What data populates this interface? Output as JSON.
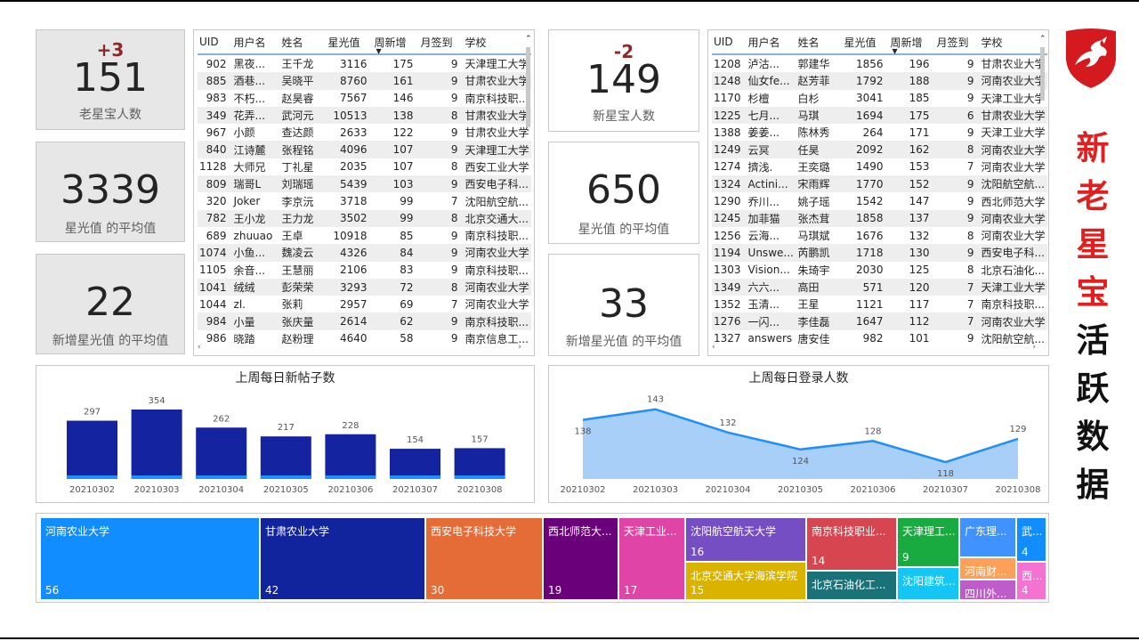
{
  "title_chars": [
    {
      "c": "新",
      "color": "#e02020"
    },
    {
      "c": "老",
      "color": "#e02020"
    },
    {
      "c": "星",
      "color": "#e02020"
    },
    {
      "c": "宝",
      "color": "#e02020"
    },
    {
      "c": "活",
      "color": "#111111"
    },
    {
      "c": "跃",
      "color": "#111111"
    },
    {
      "c": "数",
      "color": "#111111"
    },
    {
      "c": "据",
      "color": "#111111"
    }
  ],
  "logo_icon": "red-dragon-shield-icon",
  "old_cards": [
    {
      "delta": "+3",
      "value": "151",
      "label": "老星宝人数"
    },
    {
      "value": "3339",
      "label": "星光值 的平均值"
    },
    {
      "value": "22",
      "label": "新增星光值 的平均值"
    }
  ],
  "new_cards": [
    {
      "delta": "-2",
      "value": "149",
      "label": "新星宝人数"
    },
    {
      "value": "650",
      "label": "星光值 的平均值"
    },
    {
      "value": "33",
      "label": "新增星光值 的平均值"
    }
  ],
  "table_headers": [
    "UID",
    "用户名",
    "姓名",
    "星光值",
    "周新增",
    "月签到",
    "学校"
  ],
  "old_table": [
    [
      "902",
      "黑夜...",
      "王千龙",
      "3116",
      "175",
      "9",
      "天津理工大学"
    ],
    [
      "885",
      "酒巷...",
      "吴晓平",
      "8760",
      "161",
      "9",
      "甘肃农业大学"
    ],
    [
      "983",
      "不朽...",
      "赵昊睿",
      "7567",
      "146",
      "9",
      "南京科技职..."
    ],
    [
      "349",
      "花弄...",
      "武河元",
      "10513",
      "138",
      "8",
      "甘肃农业大学"
    ],
    [
      "967",
      "小颜",
      "查达颜",
      "2633",
      "122",
      "9",
      "甘肃农业大学"
    ],
    [
      "840",
      "江诗麓",
      "张程铭",
      "4096",
      "107",
      "9",
      "天津理工大学"
    ],
    [
      "1128",
      "大师兄",
      "丁礼星",
      "2035",
      "107",
      "8",
      "西安工业大学"
    ],
    [
      "809",
      "瑞哥L",
      "刘瑞瑶",
      "5439",
      "103",
      "9",
      "西安电子科..."
    ],
    [
      "320",
      "Joker",
      "李京沅",
      "3718",
      "99",
      "7",
      "沈阳航空航..."
    ],
    [
      "782",
      "王小龙",
      "王力龙",
      "3502",
      "99",
      "8",
      "北京交通大..."
    ],
    [
      "689",
      "zhuuao",
      "王卓",
      "10918",
      "85",
      "9",
      "南京科技职..."
    ],
    [
      "1074",
      "小鱼...",
      "魏凌云",
      "4326",
      "84",
      "9",
      "河南农业大学"
    ],
    [
      "1105",
      "余音...",
      "王慧丽",
      "2106",
      "83",
      "9",
      "南京科技职..."
    ],
    [
      "1041",
      "绒绒",
      "彭荣荣",
      "3293",
      "72",
      "8",
      "河南农业大学"
    ],
    [
      "1044",
      "zl.",
      "张莉",
      "2957",
      "69",
      "7",
      "河南农业大学"
    ],
    [
      "984",
      "小量",
      "张庆量",
      "2614",
      "62",
      "9",
      "南京科技职..."
    ],
    [
      "986",
      "晓踏",
      "赵粉理",
      "4640",
      "58",
      "9",
      "南京信息工..."
    ]
  ],
  "new_table": [
    [
      "1208",
      "泸沽...",
      "郭建华",
      "1856",
      "196",
      "9",
      "甘肃农业大学"
    ],
    [
      "1248",
      "仙女fe...",
      "赵芳菲",
      "1792",
      "188",
      "9",
      "河南农业大学"
    ],
    [
      "1170",
      "杉檀",
      "白杉",
      "3041",
      "185",
      "9",
      "天津工业大学"
    ],
    [
      "1225",
      "七月...",
      "马琪",
      "1694",
      "175",
      "6",
      "甘肃农业大学"
    ],
    [
      "1388",
      "姜姜...",
      "陈林秀",
      "264",
      "171",
      "9",
      "天津工业大学"
    ],
    [
      "1249",
      "云冥",
      "任昊",
      "2092",
      "162",
      "8",
      "河南农业大学"
    ],
    [
      "1274",
      "擠浅.",
      "王奕璐",
      "1490",
      "153",
      "7",
      "河南农业大学"
    ],
    [
      "1324",
      "Actini...",
      "宋雨辉",
      "1770",
      "152",
      "9",
      "沈阳航空航..."
    ],
    [
      "1290",
      "乔川...",
      "姚子瑶",
      "1542",
      "147",
      "9",
      "西北师范大学"
    ],
    [
      "1245",
      "加菲猫",
      "张杰茸",
      "1858",
      "137",
      "9",
      "河南农业大学"
    ],
    [
      "1256",
      "云海...",
      "马琪斌",
      "1676",
      "132",
      "8",
      "河南农业大学"
    ],
    [
      "1194",
      "Unswe...",
      "芮鹏凯",
      "1718",
      "130",
      "9",
      "西安电子科..."
    ],
    [
      "1303",
      "Vision...",
      "朱琦宇",
      "2030",
      "125",
      "8",
      "北京石油化..."
    ],
    [
      "1349",
      "六六...",
      "高田",
      "571",
      "120",
      "7",
      "天津工业大学"
    ],
    [
      "1352",
      "玉清...",
      "王星",
      "1121",
      "117",
      "7",
      "南京科技职..."
    ],
    [
      "1276",
      "一闪...",
      "李佳磊",
      "1647",
      "112",
      "7",
      "河南农业大学"
    ],
    [
      "1327",
      "answers",
      "唐安佳",
      "982",
      "101",
      "9",
      "沈阳航空航..."
    ]
  ],
  "posts_chart": {
    "title": "上周每日新帖子数",
    "type": "bar",
    "categories": [
      "20210302",
      "20210303",
      "20210304",
      "20210305",
      "20210306",
      "20210307",
      "20210308"
    ],
    "values": [
      297,
      354,
      262,
      217,
      228,
      154,
      157
    ],
    "bar_color": "#1424a0",
    "accent_color": "#1f8fff"
  },
  "login_chart": {
    "title": "上周每日登录人数",
    "type": "area",
    "categories": [
      "20210302",
      "20210303",
      "20210304",
      "20210305",
      "20210306",
      "20210307",
      "20210308"
    ],
    "values": [
      138,
      143,
      132,
      124,
      128,
      118,
      129
    ],
    "line_color": "#1f8fff",
    "fill_color": "#a7cff7"
  },
  "chart_data": [
    {
      "type": "bar",
      "title": "上周每日新帖子数",
      "categories": [
        "20210302",
        "20210303",
        "20210304",
        "20210305",
        "20210306",
        "20210307",
        "20210308"
      ],
      "values": [
        297,
        354,
        262,
        217,
        228,
        154,
        157
      ]
    },
    {
      "type": "area",
      "title": "上周每日登录人数",
      "categories": [
        "20210302",
        "20210303",
        "20210304",
        "20210305",
        "20210306",
        "20210307",
        "20210308"
      ],
      "values": [
        138,
        143,
        132,
        124,
        128,
        118,
        129
      ]
    }
  ],
  "treemap": [
    {
      "name": "河南农业大学",
      "count": "56",
      "color": "#118dff"
    },
    {
      "name": "甘肃农业大学",
      "count": "42",
      "color": "#12239e"
    },
    {
      "name": "西安电子科技大学",
      "count": "30",
      "color": "#e66c37"
    },
    {
      "name": "西北师范大...",
      "count": "19",
      "color": "#6b007b"
    },
    {
      "name": "天津工业...",
      "count": "17",
      "color": "#e044a7"
    },
    {
      "name": "沈阳航空航天大学",
      "count": "16",
      "color": "#744ec2"
    },
    {
      "name": "北京交通大学海滨学院",
      "count": "15",
      "color": "#d9b300"
    },
    {
      "name": "南京科技职业...",
      "count": "14",
      "color": "#d64550"
    },
    {
      "name": "北京石油化工...",
      "count": "",
      "color": "#197278"
    },
    {
      "name": "天津理工...",
      "count": "9",
      "color": "#1aab40"
    },
    {
      "name": "沈阳建筑...",
      "count": "",
      "color": "#15c6f4"
    },
    {
      "name": "广东理...",
      "count": "",
      "color": "#4092ff"
    },
    {
      "name": "河南财...",
      "count": "",
      "color": "#ffa058"
    },
    {
      "name": "四川外...",
      "count": "",
      "color": "#be5dc9"
    },
    {
      "name": "武...",
      "count": "4",
      "color": "#118dff"
    },
    {
      "name": "西...",
      "count": "4",
      "color": "#f472d0"
    }
  ]
}
